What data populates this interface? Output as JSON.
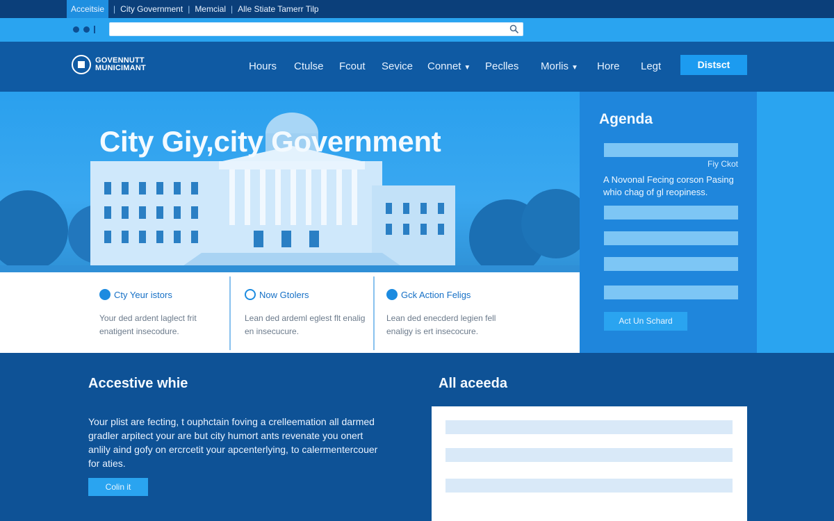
{
  "topbar": {
    "items": [
      "Acceitsie",
      "City Government",
      "Memcial",
      "Alle Stiate Tamerr Tilp"
    ]
  },
  "header": {
    "logo_line1": "GOVENNUTT",
    "logo_line2": "MUNICIMANT",
    "nav": [
      "Hours",
      "Ctulse",
      "Fcout",
      "Sevice",
      "Connet",
      "Peclles",
      "Morlis",
      "Hore",
      "Legt"
    ],
    "cta": "Distsct"
  },
  "hero": {
    "title": "City  Giy,city Government"
  },
  "agenda": {
    "title": "Agenda",
    "byline": "Fiy Ckot",
    "description": "A Novonal Fecing corson Pasing whio chag of gl reopiness.",
    "button": "Act Un Schard"
  },
  "features": [
    {
      "title": "Cty Yeur istors",
      "text": "Your ded ardent laglect frit enatigent insecodure."
    },
    {
      "title": "Now Gtolers",
      "text": "Lean ded ardeml eglest flt enalig en insecucure."
    },
    {
      "title": "Gck Action Feligs",
      "text": "Lean ded enecderd legien fell enaligy is ert insecocure."
    }
  ],
  "bottom": {
    "left_title": "Accestive whie",
    "paragraph": "Your plist are fecting, t ouphctain foving a crelleemation all darmed gradler arpitect your are but city humort ants revenate you onert anlily aind gofy on ercrcetit your apcenterlying, to calermentercouer for aties.",
    "button": "Colin it",
    "right_title": "All aceeda"
  },
  "colors": {
    "navy": "#0d4f93",
    "header": "#0f5aa3",
    "accent": "#2aa4f0",
    "panel": "#1f86dc"
  },
  "icons": [
    "search-icon",
    "logo-icon",
    "chevron-down-icon",
    "info-circle-icon",
    "refresh-circle-icon",
    "facebook-circle-icon"
  ]
}
